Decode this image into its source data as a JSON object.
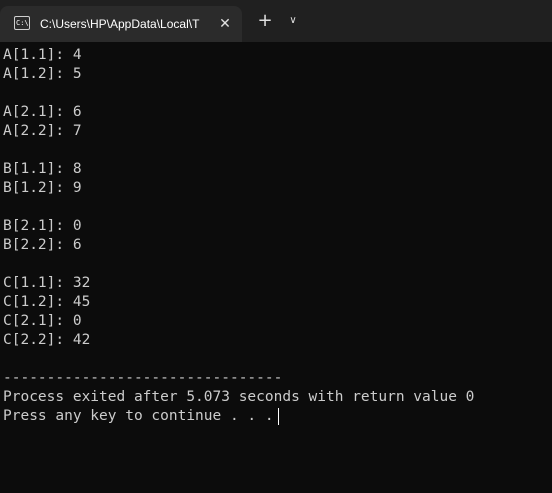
{
  "tab": {
    "icon_text": "C:\\",
    "title": "C:\\Users\\HP\\AppData\\Local\\T",
    "close_glyph": "✕",
    "new_tab_glyph": "+",
    "dropdown_glyph": "∨"
  },
  "terminal": {
    "lines": [
      "A[1.1]: 4",
      "A[1.2]: 5",
      "",
      "A[2.1]: 6",
      "A[2.2]: 7",
      "",
      "B[1.1]: 8",
      "B[1.2]: 9",
      "",
      "B[2.1]: 0",
      "B[2.2]: 6",
      "",
      "C[1.1]: 32",
      "C[1.2]: 45",
      "C[2.1]: 0",
      "C[2.2]: 42",
      "",
      "--------------------------------",
      "Process exited after 5.073 seconds with return value 0",
      "Press any key to continue . . ."
    ]
  },
  "colors": {
    "background": "#0c0c0c",
    "titlebar": "#202020",
    "active_tab": "#2b2b2b",
    "text": "#cccccc"
  }
}
